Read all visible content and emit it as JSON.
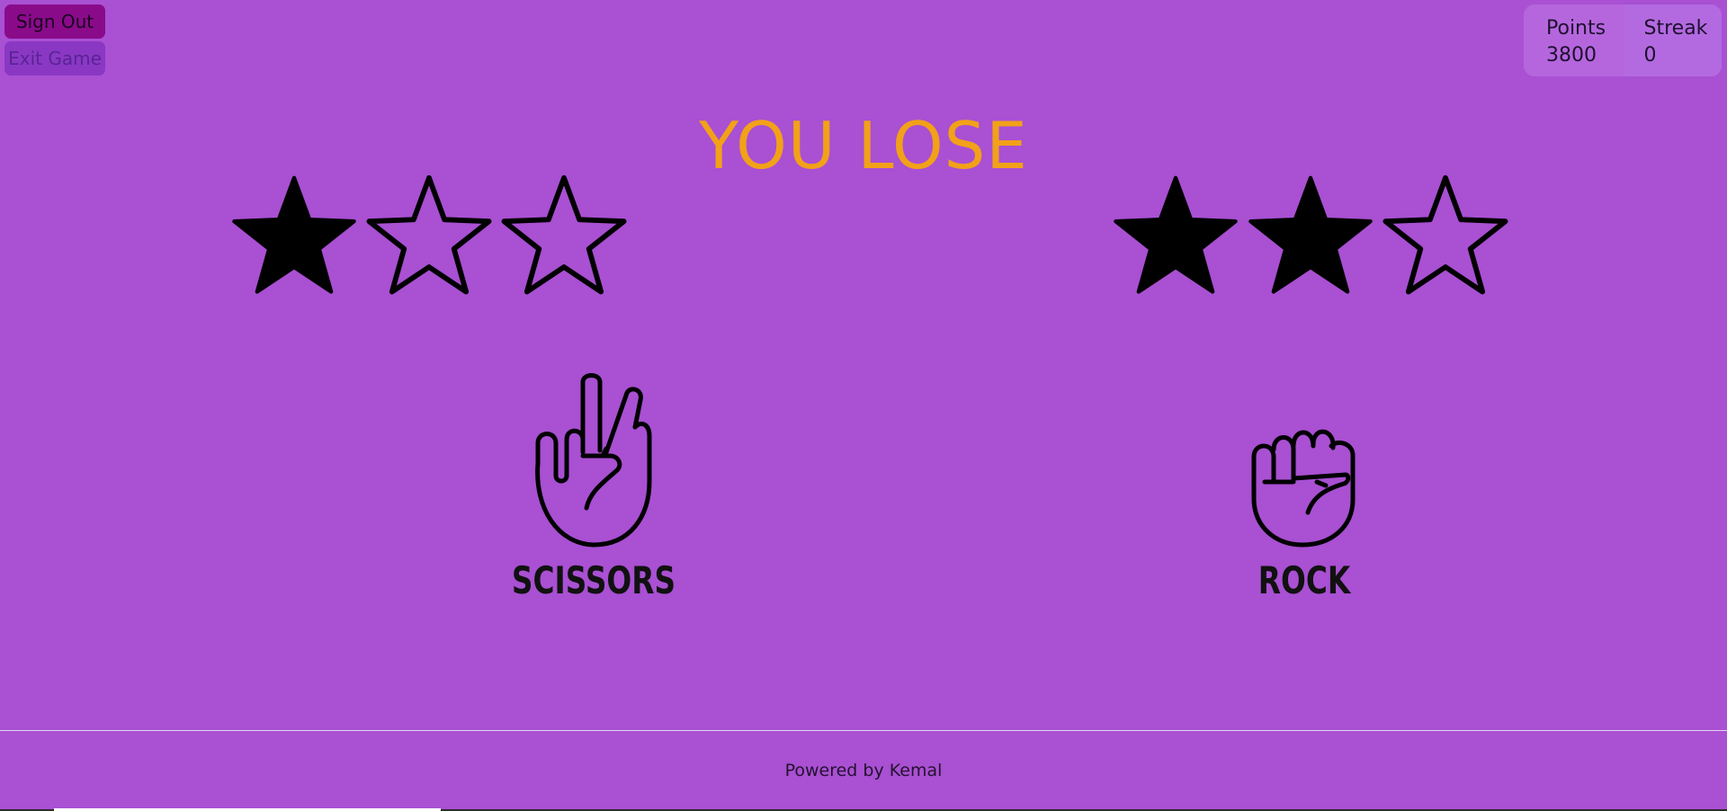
{
  "controls": {
    "sign_out_label": "Sign Out",
    "exit_game_label": "Exit Game"
  },
  "stats": {
    "points_label": "Points",
    "points_value": "3800",
    "streak_label": "Streak",
    "streak_value": "0"
  },
  "result": {
    "text": "YOU LOSE",
    "color": "#f2a118"
  },
  "player": {
    "stars_filled": 1,
    "stars_total": 3,
    "choice": "SCISSORS",
    "icon": "scissors-hand-icon"
  },
  "opponent": {
    "stars_filled": 2,
    "stars_total": 3,
    "choice": "ROCK",
    "icon": "rock-fist-icon"
  },
  "footer": {
    "text": "Powered by Kemal"
  },
  "colors": {
    "background": "#a950d3",
    "sign_out_bg": "#8a0b8a",
    "exit_game_bg": "#8a38c4",
    "stats_bg": "#b566dd"
  }
}
